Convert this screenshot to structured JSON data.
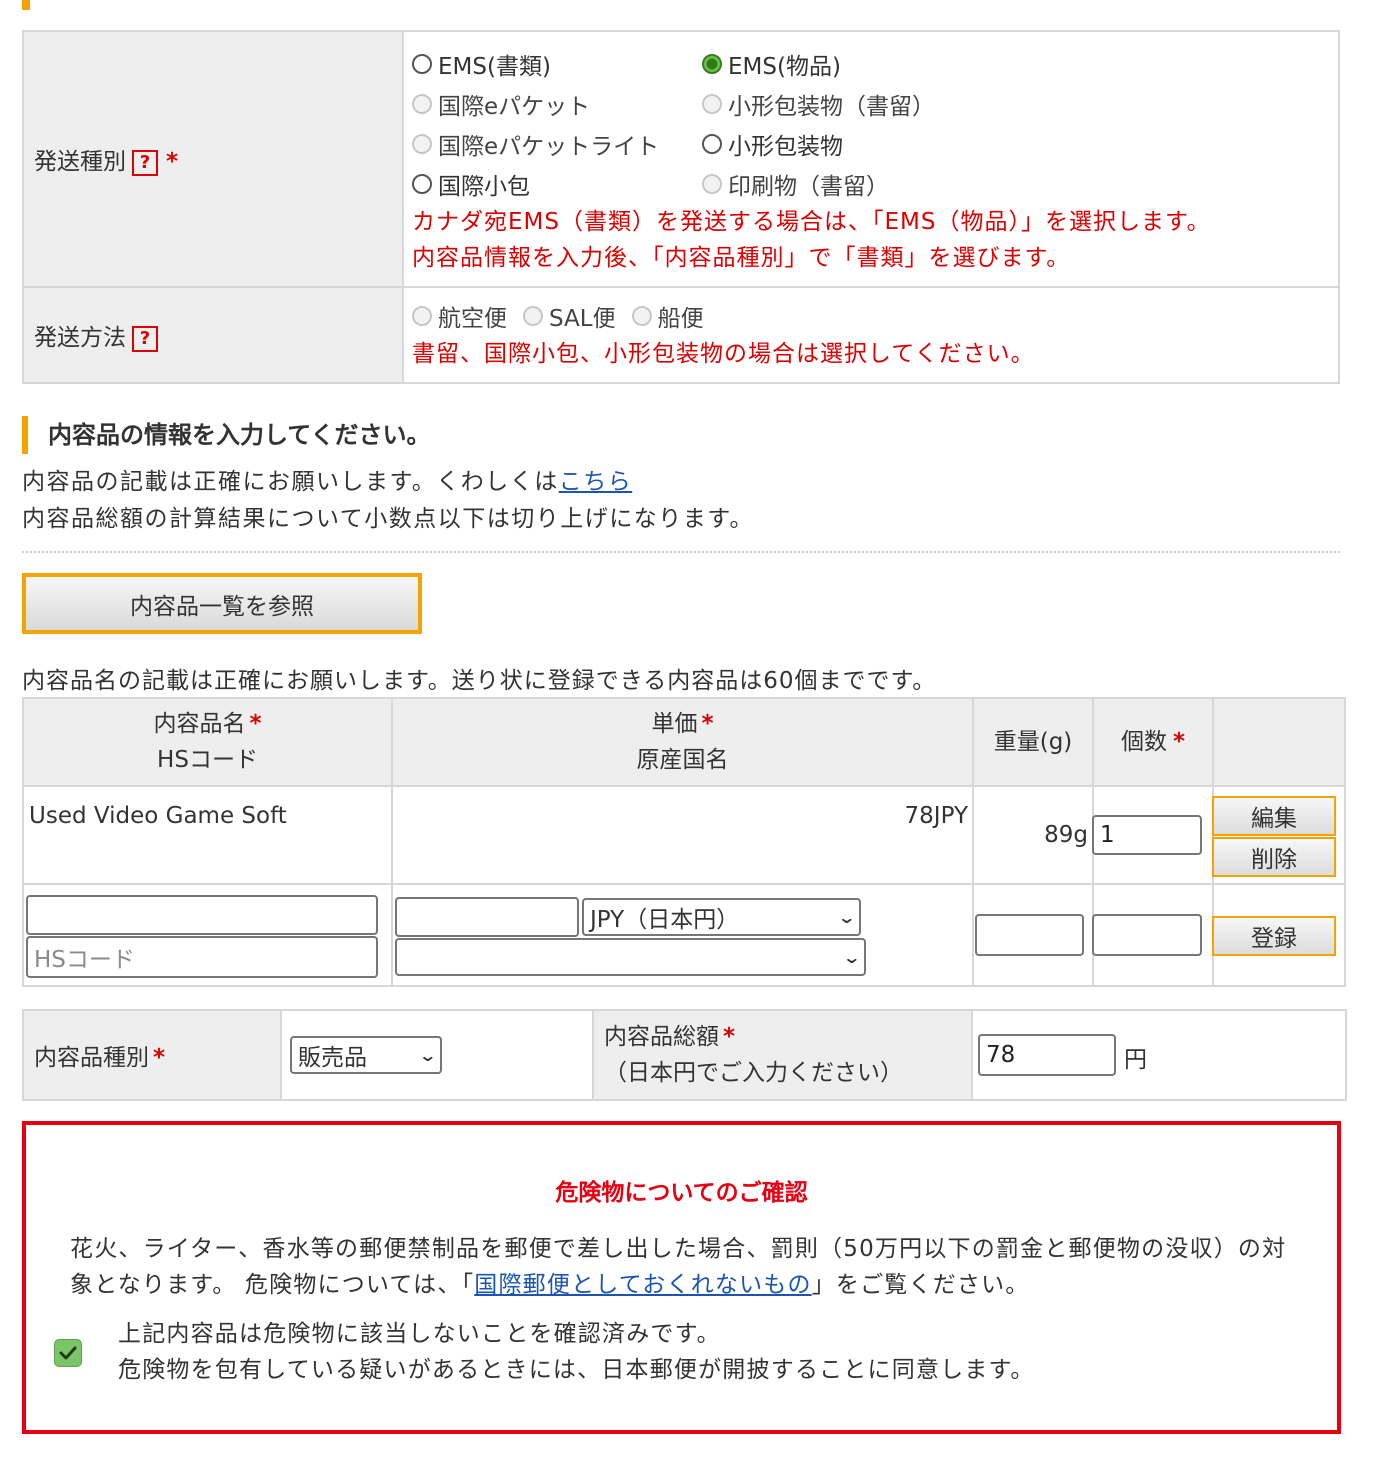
{
  "shipping_type": {
    "label": "発送種別",
    "help": "?",
    "required": "*",
    "options": [
      {
        "label": "EMS(書類)",
        "state": "enabled"
      },
      {
        "label": "EMS(物品)",
        "state": "checked"
      },
      {
        "label": "国際eパケット",
        "state": "disabled"
      },
      {
        "label": "小形包装物（書留）",
        "state": "disabled"
      },
      {
        "label": "国際eパケットライト",
        "state": "disabled"
      },
      {
        "label": "小形包装物",
        "state": "enabled"
      },
      {
        "label": "国際小包",
        "state": "enabled"
      },
      {
        "label": "印刷物（書留）",
        "state": "disabled"
      }
    ],
    "note1": "カナダ宛EMS（書類）を発送する場合は、「EMS（物品）」を選択します。",
    "note2": "内容品情報を入力後、「内容品種別」で「書類」を選びます。"
  },
  "shipping_method": {
    "label": "発送方法",
    "help": "?",
    "options": [
      "航空便",
      "SAL便",
      "船便"
    ],
    "note": "書留、国際小包、小形包装物の場合は選択してください。"
  },
  "contents_section": {
    "heading": "内容品の情報を入力してください。",
    "line1": "内容品の記載は正確にお願いします。くわしくは",
    "line1_link": "こちら",
    "line2": "内容品総額の計算結果について小数点以下は切り上げになります。",
    "list_button": "内容品一覧を参照",
    "table_note": "内容品名の記載は正確にお願いします。送り状に登録できる内容品は60個までです。"
  },
  "items_table": {
    "head_name": "内容品名",
    "head_hs": "HSコード",
    "head_price": "単価",
    "head_origin": "原産国名",
    "head_weight": "重量(g)",
    "head_qty": "個数",
    "required": "*",
    "row": {
      "name": "Used Video Game Soft",
      "price": "78JPY",
      "weight": "89g",
      "qty": "1"
    },
    "edit_button": "編集",
    "delete_button": "削除",
    "hs_placeholder": "HSコード",
    "currency_value": "JPY（日本円）",
    "register_button": "登録"
  },
  "summary": {
    "type_label": "内容品種別",
    "type_value": "販売品",
    "total_label": "内容品総額",
    "total_sub": "（日本円でご入力ください）",
    "total_value": "78",
    "unit": "円",
    "required": "*"
  },
  "warning": {
    "title": "危険物についてのご確認",
    "text_a": "花火、ライター、香水等の郵便禁制品を郵便で差し出した場合、罰則（50万円以下の罰金と郵便物の没収）の対象となります。 危険物については、「",
    "link": "国際郵便としておくれないもの",
    "text_b": "」をご覧ください。",
    "check_line1": "上記内容品は危険物に該当しないことを確認済みです。",
    "check_line2": "危険物を包有している疑いがあるときには、日本郵便が開披することに同意します。",
    "checked": true
  }
}
